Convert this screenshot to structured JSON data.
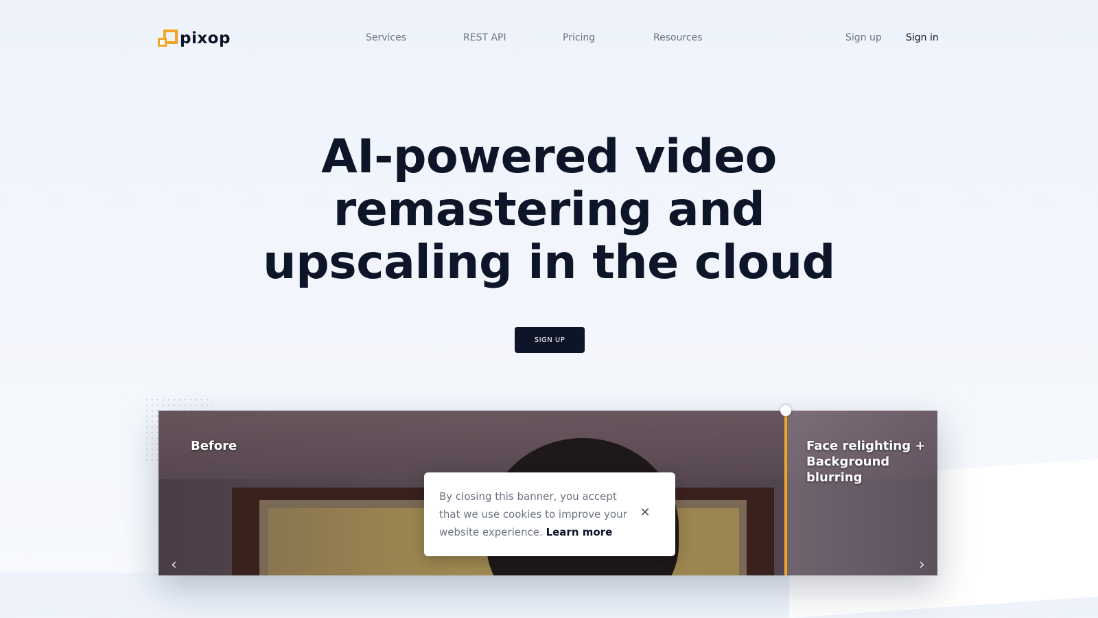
{
  "brand": {
    "name": "pixop"
  },
  "nav": {
    "links": [
      "Services",
      "REST API",
      "Pricing",
      "Resources"
    ],
    "sign_up": "Sign up",
    "sign_in": "Sign in"
  },
  "hero": {
    "title": "AI-powered video remastering and upscaling in the cloud",
    "cta": "SIGN UP"
  },
  "comparison": {
    "before_label": "Before",
    "after_label": "Face relighting + Background blurring",
    "prev_icon": "chevron-left-icon",
    "next_icon": "chevron-right-icon",
    "divider_color": "#f3a526"
  },
  "cookie_banner": {
    "text": "By closing this banner, you accept that we use cookies to improve your website experience.",
    "link": "Learn more",
    "close_icon": "close-icon"
  },
  "colors": {
    "accent": "#f3a526",
    "primary_dark": "#0d1628",
    "nav_text": "#6b7280"
  }
}
